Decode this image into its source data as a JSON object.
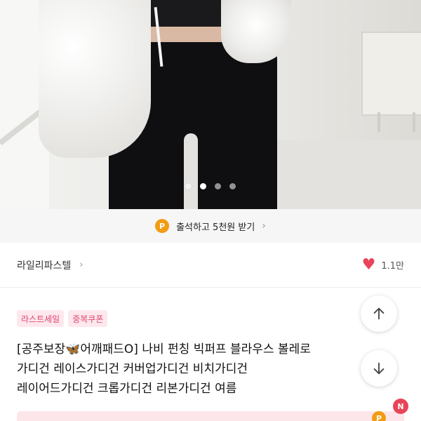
{
  "carousel": {
    "image_alt": "product-photo",
    "dots": [
      false,
      true,
      false,
      false
    ]
  },
  "attendance": {
    "badge": "P",
    "label": "출석하고 5천원 받기",
    "chevron": "›"
  },
  "seller": {
    "name": "라일리파스텔",
    "chevron": "›",
    "likes": "1.1만",
    "heart_icon": "heart-icon"
  },
  "tags": [
    "라스트세일",
    "중복쿠폰"
  ],
  "product": {
    "title_lines": [
      "[공주보장🦋어깨패드O] 나비 펀칭 빅퍼프 블라우스 볼레로",
      "가디건 레이스가디건 커버업가디건 비치가디건",
      "레이어드가디건 크롭가디건 리본가디건 여름"
    ]
  },
  "fabs": {
    "up_icon": "arrow-up-icon",
    "down_icon": "arrow-down-icon"
  },
  "bottom": {
    "point_badge": "P",
    "notification_badge": "N"
  },
  "colors": {
    "accent_pink": "#e8445a",
    "tag_bg": "#fde8ee",
    "tag_text": "#e2456e",
    "point_orange": "#f39c12"
  }
}
